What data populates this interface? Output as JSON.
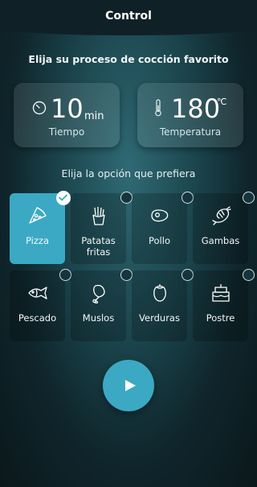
{
  "header": {
    "title": "Control"
  },
  "main": {
    "subtitle": "Elija su proceso de cocción favorito",
    "options_title": "Elija la opción que prefiera"
  },
  "time": {
    "value": "10",
    "unit": "min",
    "label": "Tiempo"
  },
  "temperature": {
    "value": "180",
    "unit": "℃",
    "label": "Temperatura"
  },
  "options": [
    {
      "label": "Pizza",
      "selected": true,
      "icon": "pizza-icon"
    },
    {
      "label": "Patatas fritas",
      "selected": false,
      "icon": "fries-icon"
    },
    {
      "label": "Pollo",
      "selected": false,
      "icon": "steak-icon"
    },
    {
      "label": "Gambas",
      "selected": false,
      "icon": "shrimp-icon"
    },
    {
      "label": "Pescado",
      "selected": false,
      "icon": "fish-icon"
    },
    {
      "label": "Muslos",
      "selected": false,
      "icon": "drumstick-icon"
    },
    {
      "label": "Verduras",
      "selected": false,
      "icon": "eggplant-icon"
    },
    {
      "label": "Postre",
      "selected": false,
      "icon": "cake-icon"
    }
  ],
  "colors": {
    "accent": "#3ba9c4",
    "background": "#1b444c"
  },
  "controls": {
    "play_icon": "play-icon"
  }
}
